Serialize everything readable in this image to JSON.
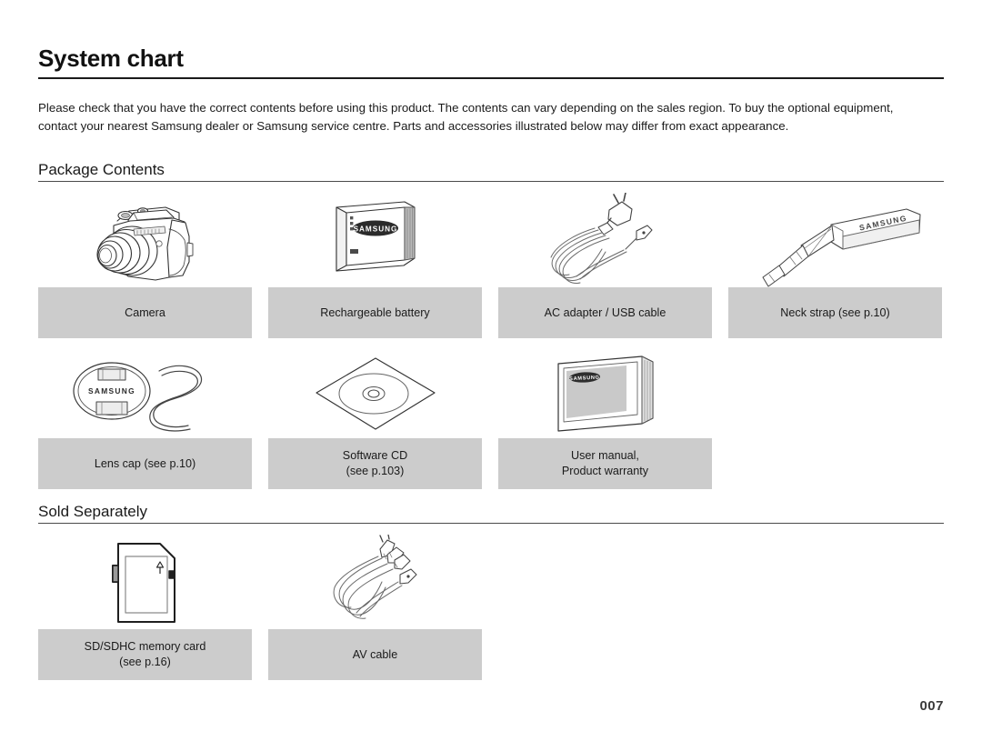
{
  "document": {
    "title": "System chart",
    "intro": "Please check that you have the correct contents before using this product. The contents can vary depending on the sales region. To buy the optional equipment, contact your nearest Samsung dealer or Samsung service centre. Parts and accessories illustrated below may differ from exact appearance.",
    "page_number": "007",
    "brand": "SAMSUNG",
    "colors": {
      "label_box_background": "#cccccc",
      "text": "#1a1a1a",
      "title_rule": "#1a1a1a",
      "section_rule": "#4a4a4a",
      "page_number": "#3a3a3a",
      "artwork_line": "#333333",
      "artwork_fill": "#d4d4d4"
    }
  },
  "sections": [
    {
      "heading": "Package Contents",
      "rows": [
        [
          {
            "icon": "camera-illustration",
            "label_line1": "Camera",
            "label_line2": ""
          },
          {
            "icon": "rechargeable-battery-illustration",
            "label_line1": "Rechargeable battery",
            "label_line2": ""
          },
          {
            "icon": "ac-adapter-usb-cable-illustration",
            "label_line1": "AC adapter / USB cable",
            "label_line2": ""
          },
          {
            "icon": "neck-strap-illustration",
            "label_line1": "Neck strap (see p.10)",
            "label_line2": ""
          }
        ],
        [
          {
            "icon": "lens-cap-illustration",
            "label_line1": "Lens cap (see p.10)",
            "label_line2": ""
          },
          {
            "icon": "software-cd-illustration",
            "label_line1": "Software CD",
            "label_line2": "(see p.103)"
          },
          {
            "icon": "user-manual-illustration",
            "label_line1": "User manual,",
            "label_line2": "Product warranty"
          }
        ]
      ]
    },
    {
      "heading": "Sold Separately",
      "rows": [
        [
          {
            "icon": "sd-sdhc-memory-card-illustration",
            "label_line1": "SD/SDHC memory card",
            "label_line2": "(see p.16)"
          },
          {
            "icon": "av-cable-illustration",
            "label_line1": "AV cable",
            "label_line2": ""
          }
        ]
      ]
    }
  ]
}
